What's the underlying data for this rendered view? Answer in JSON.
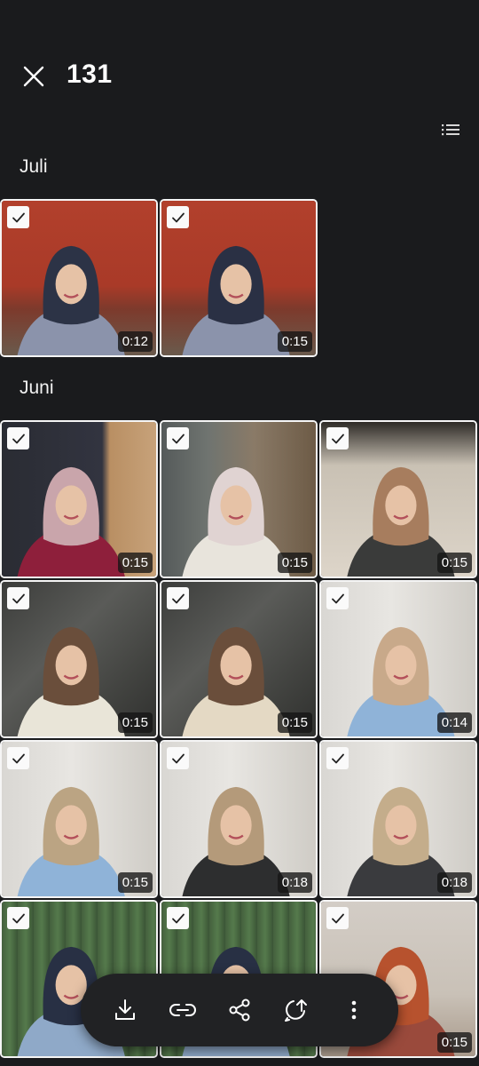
{
  "header": {
    "title": "131"
  },
  "sections": [
    {
      "label": "Juli",
      "items": [
        {
          "duration": "0:12",
          "scene": "red-tile-wall",
          "hijab": "#2c3346",
          "top": "#8b93ab"
        },
        {
          "duration": "0:15",
          "scene": "red-tile-wall",
          "hijab": "#2a3044",
          "top": "#8b93ab"
        }
      ]
    },
    {
      "label": "Juni",
      "items": [
        {
          "duration": "0:15",
          "scene": "dark-door",
          "hijab": "#c9a5ab",
          "top": "#8e1f3b"
        },
        {
          "duration": "0:15",
          "scene": "room-shelf",
          "hijab": "#e0d3d2",
          "top": "#e8e4dc"
        },
        {
          "duration": "0:15",
          "scene": "white-wall-door",
          "hijab": "#a77d5e",
          "top": "#3a3b3a"
        },
        {
          "duration": "0:15",
          "scene": "grey-marble",
          "hijab": "#6a4e3b",
          "top": "#e9e5d8"
        },
        {
          "duration": "0:15",
          "scene": "grey-marble",
          "hijab": "#6a4e3b",
          "top": "#e4d9c4"
        },
        {
          "duration": "0:14",
          "scene": "white-marble-door",
          "hijab": "#c8a98a",
          "top": "#8fb3d8"
        },
        {
          "duration": "0:15",
          "scene": "white-marble-door",
          "hijab": "#bba483",
          "top": "#8fb3d8"
        },
        {
          "duration": "0:18",
          "scene": "white-marble-door",
          "hijab": "#b49a7a",
          "top": "#2d2e2f"
        },
        {
          "duration": "0:18",
          "scene": "white-marble-door",
          "hijab": "#c4ad8b",
          "top": "#3a3b3e"
        },
        {
          "duration": "",
          "scene": "green-curtain",
          "hijab": "#283044",
          "top": "#8fa9c8"
        },
        {
          "duration": "",
          "scene": "green-curtain",
          "hijab": "#283044",
          "top": "#8fa9c8"
        },
        {
          "duration": "0:15",
          "scene": "tiled-room",
          "hijab": "#b7522e",
          "top": "#9a4a3c"
        }
      ]
    }
  ],
  "toolbar": {
    "buttons": [
      {
        "icon": "download-icon"
      },
      {
        "icon": "link-icon"
      },
      {
        "icon": "share-icon"
      },
      {
        "icon": "upload-icon"
      },
      {
        "icon": "more-vertical-icon"
      }
    ]
  },
  "colors": {
    "background": "#1a1b1d",
    "toolbar": "#212224",
    "text": "#ffffff",
    "thumb_border": "#f5f5f5"
  }
}
